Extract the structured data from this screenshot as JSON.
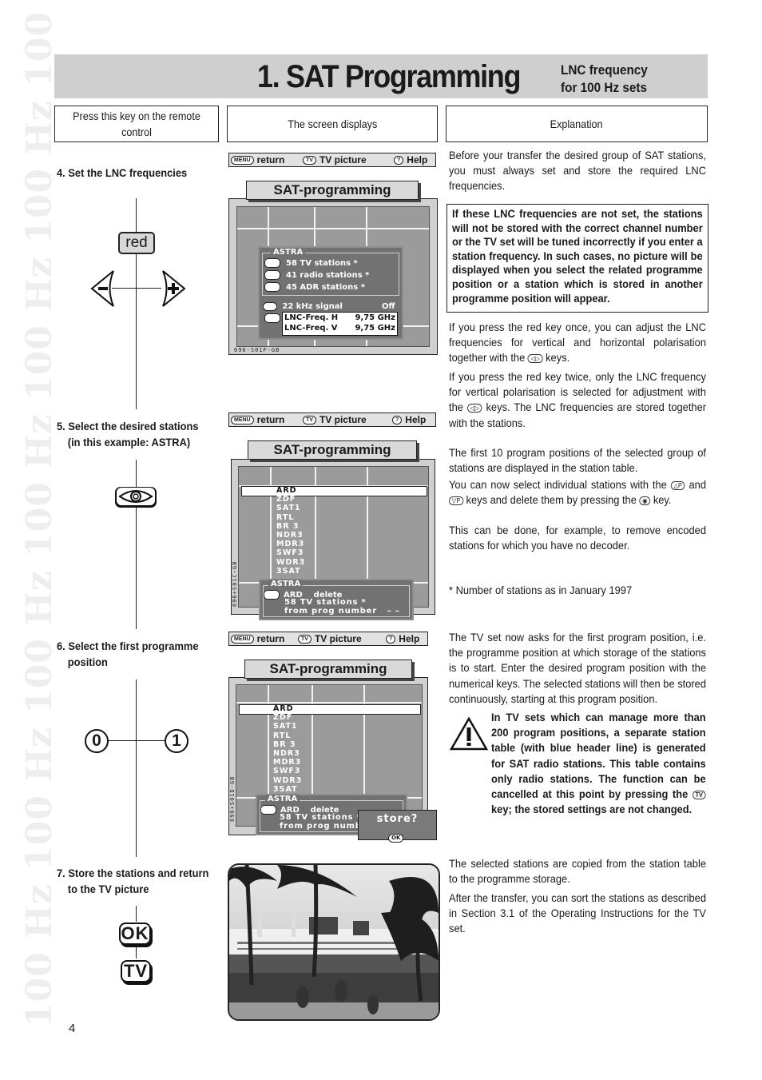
{
  "watermark": "100 Hz 100 Hz 100 Hz 100 Hz 100 Hz 100 Hz 100 Hz",
  "header": {
    "title": "1. SAT Programming",
    "subtitle_line1": "LNC frequency",
    "subtitle_line2": "for 100 Hz sets"
  },
  "columns": {
    "col1": "Press this key on the remote control",
    "col2": "The screen displays",
    "col3": "Explanation"
  },
  "steps": [
    {
      "label": "4. Set the LNC frequencies",
      "keys": {
        "red": "red",
        "minus": "−",
        "plus": "+"
      }
    },
    {
      "label_line1": "5. Select the desired stations",
      "label_line2": "(in this example: ASTRA)",
      "key": "eye-key"
    },
    {
      "label_line1": "6. Select the first programme",
      "label_line2": "position",
      "keys": [
        "0",
        "1"
      ]
    },
    {
      "label_line1": "7. Store the stations and return",
      "label_line2": "to the TV picture",
      "keys": [
        "OK",
        "TV"
      ]
    }
  ],
  "menubar": {
    "menu_pill": "MENU",
    "return": "return",
    "tv_pill": "TV",
    "tv_picture": "TV picture",
    "help_pill": "?",
    "help": "Help"
  },
  "screen1": {
    "banner": "SAT-programming",
    "group": "ASTRA",
    "rows": [
      "58 TV stations *",
      "41 radio stations *",
      "45 ADR stations *"
    ],
    "av_pill": "AV",
    "signal_label": "22 kHz signal",
    "signal_value": "Off",
    "lnc_h_label": "LNC-Freq. H",
    "lnc_h_value": "9,75 GHz",
    "lnc_v_label": "LNC-Freq. V",
    "lnc_v_value": "9,75 GHz",
    "code": "696-S01F-GB"
  },
  "screen2": {
    "banner": "SAT-programming",
    "stations": [
      "ARD",
      "ZDF",
      "SAT1",
      "RTL",
      "BR 3",
      "NDR3",
      "MDR3",
      "SWF3",
      "WDR3",
      "3SAT"
    ],
    "group": "ASTRA",
    "line1": "ARD    delete",
    "line2": "58 TV stations *",
    "line3": "from prog number   – –",
    "code": "696+S01C-GB"
  },
  "screen3": {
    "banner": "SAT-programming",
    "stations": [
      "ARD",
      "ZDF",
      "SAT1",
      "RTL",
      "BR 3",
      "NDR3",
      "MDR3",
      "SWF3",
      "WDR3",
      "3SAT"
    ],
    "group": "ASTRA",
    "line1": "ARD    delete",
    "line2": "58 TV stations *",
    "line3": "from prog number",
    "store_prompt": "store?",
    "ok_pill": "OK",
    "code": "696+S01D-GB"
  },
  "explanations": {
    "e1": "Before your transfer the desired group of SAT stations, you must always set and store the required LNC frequencies.",
    "warning_box": "If these LNC frequencies are not set, the stations will not be stored with the correct channel number or the TV set will be tuned incorrectly if you enter a station frequency. In such cases, no picture will be displayed when you select the related programme position or a station which is stored in another programme position will appear.",
    "e2a": "If you press the red key once, you can adjust the LNC frequencies for vertical and horizontal polarisation together with the",
    "e2b": "keys.",
    "e3a": "If you press the red key twice, only the LNC frequency for vertical polarisation is selected for adjustment with the",
    "e3b": "keys. The LNC frequencies are stored together with the stations.",
    "e4": "The first 10 program positions of the selected group of stations are displayed in the station table.",
    "e5a": "You can now select individual stations with the",
    "e5b": "and",
    "e5c": "keys and delete them by pressing the",
    "e5d": "key.",
    "e6": "This can be done, for example, to remove encoded stations for which you have no decoder.",
    "footnote": "* Number of stations as in January 1997",
    "e7": "The TV set now asks for the first program position, i.e. the programme position at which storage of the stations is to start. Enter the desired program position with the numerical keys. The selected stations will then be stored continuously, starting at this program position.",
    "warning_a": "In TV sets which can manage more than 200 program positions, a separate station table (with blue header line) is generated for SAT radio stations. This table contains only radio stations. The function can be cancelled at this point by pressing the",
    "warning_b": "key; the stored settings are not changed.",
    "e8": "The selected stations are copied from the station table to the programme storage.",
    "e9": "After the transfer, you can sort the stations as described in Section 3.1 of the Operating Instructions for the TV set."
  },
  "inline_icons": {
    "arrows": "◁▷",
    "p_up": "△P",
    "p_down": "▽P",
    "eye": "◉",
    "tv": "TV"
  },
  "page_number": "4"
}
